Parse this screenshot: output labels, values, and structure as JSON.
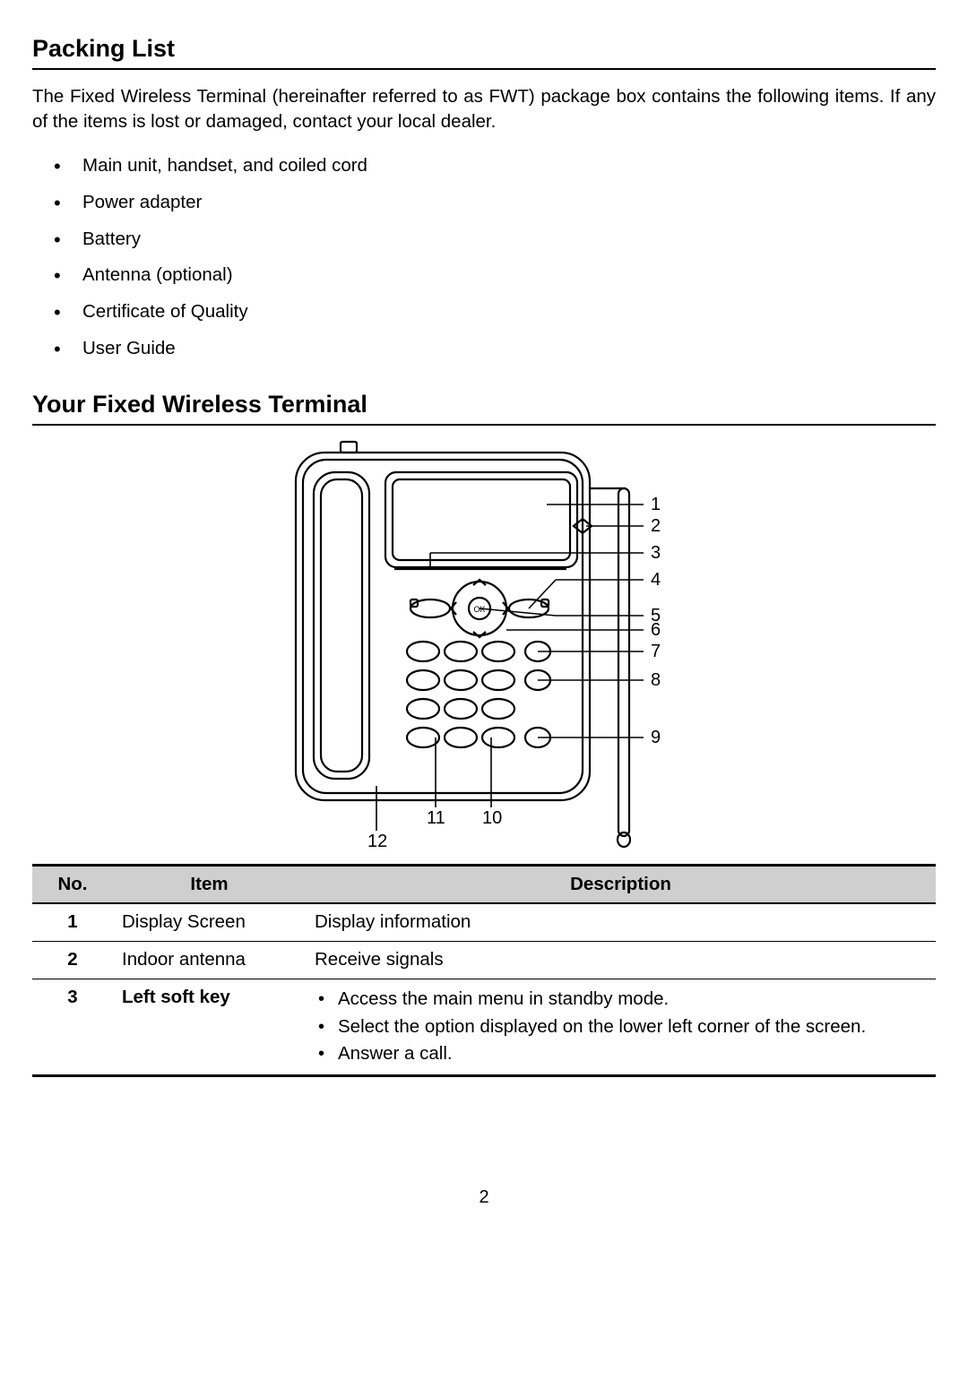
{
  "section1": {
    "title": "Packing List",
    "intro": "The Fixed Wireless Terminal (hereinafter referred to as FWT) package box contains the following items. If any of the items is lost or damaged, contact your local dealer.",
    "items": [
      "Main unit, handset, and coiled cord",
      "Power adapter",
      "Battery",
      "Antenna (optional)",
      "Certificate of Quality",
      "User Guide"
    ]
  },
  "section2": {
    "title": "Your Fixed Wireless Terminal",
    "diagram_callouts": [
      "1",
      "2",
      "3",
      "4",
      "5",
      "6",
      "7",
      "8",
      "9",
      "10",
      "11",
      "12"
    ],
    "table": {
      "headers": {
        "no": "No.",
        "item": "Item",
        "desc": "Description"
      },
      "rows": [
        {
          "no": "1",
          "item": "Display Screen",
          "desc_plain": "Display information",
          "bold_item": false
        },
        {
          "no": "2",
          "item": "Indoor antenna",
          "desc_plain": "Receive signals",
          "bold_item": false
        },
        {
          "no": "3",
          "item": "Left soft key",
          "bold_item": true,
          "desc_bullets": [
            "Access the main menu in standby mode.",
            "Select the option displayed on the lower left corner of the screen.",
            "Answer a call."
          ]
        }
      ]
    }
  },
  "page_number": "2"
}
